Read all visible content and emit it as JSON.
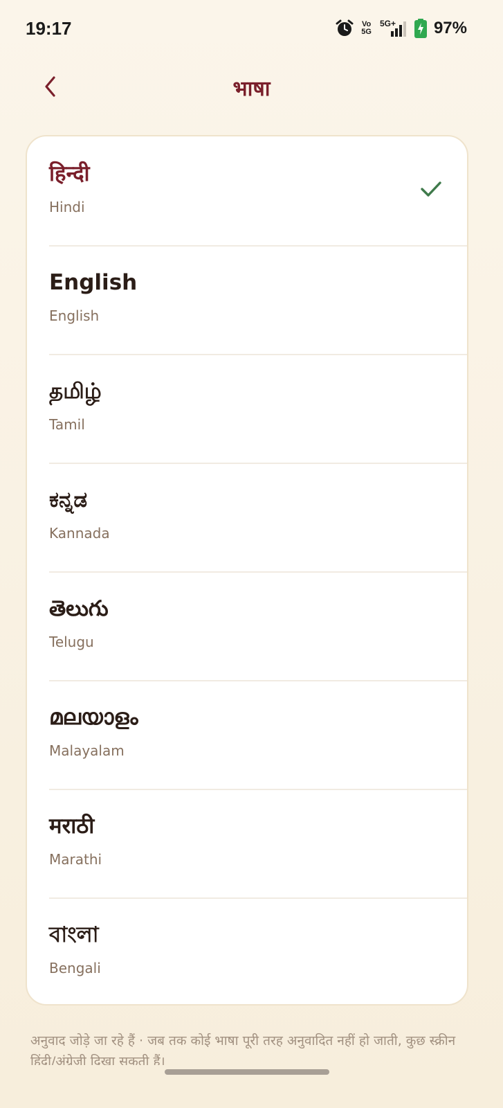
{
  "status_bar": {
    "time": "19:17",
    "volte_top": "Vo",
    "volte_bottom": "5G",
    "network": "5G+",
    "battery": "97%"
  },
  "header": {
    "title": "भाषा",
    "back_icon": "chevron-left-icon"
  },
  "colors": {
    "accent": "#7a1f2b",
    "check": "#3f7a4b",
    "background": "#fbf5ea"
  },
  "languages": [
    {
      "native": "हिन्दी",
      "english": "Hindi",
      "selected": true
    },
    {
      "native": "English",
      "english": "English",
      "selected": false
    },
    {
      "native": "தமிழ்",
      "english": "Tamil",
      "selected": false
    },
    {
      "native": "ಕನ್ನಡ",
      "english": "Kannada",
      "selected": false
    },
    {
      "native": "తెలుగు",
      "english": "Telugu",
      "selected": false
    },
    {
      "native": "മലയാളം",
      "english": "Malayalam",
      "selected": false
    },
    {
      "native": "मराठी",
      "english": "Marathi",
      "selected": false
    },
    {
      "native": "বাংলা",
      "english": "Bengali",
      "selected": false
    }
  ],
  "footer": {
    "note": "अनुवाद जोड़े जा रहे हैं · जब तक कोई भाषा पूरी तरह अनुवादित नहीं हो जाती, कुछ स्क्रीन हिंदी/अंग्रेजी दिखा सकती हैं।"
  }
}
